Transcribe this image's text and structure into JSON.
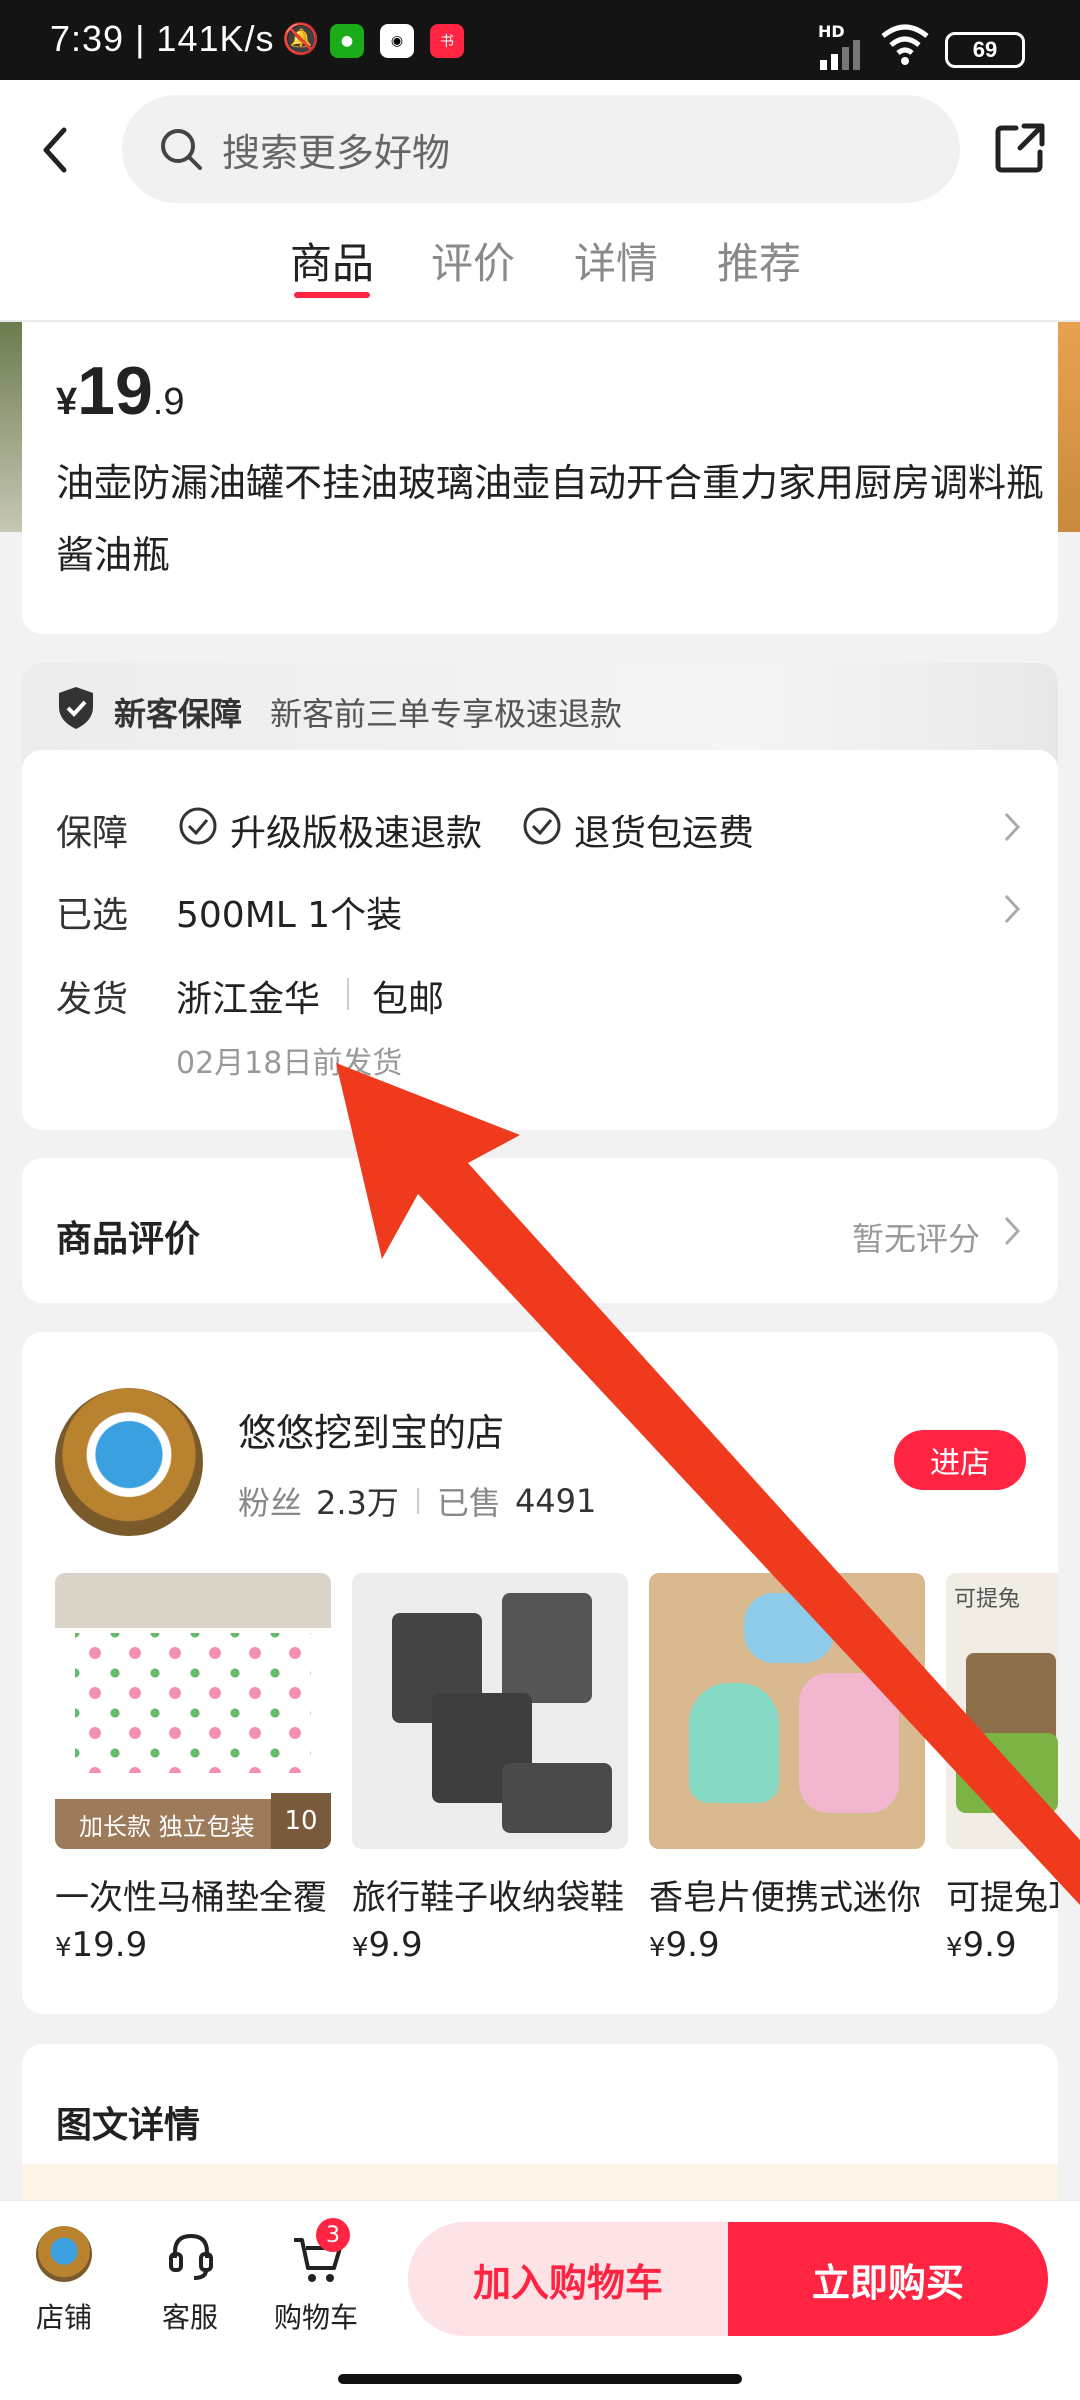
{
  "status_bar": {
    "time": "7:39 | 141K/s",
    "battery": "69",
    "network": "HD"
  },
  "header": {
    "search_placeholder": "搜索更多好物"
  },
  "tabs": [
    "商品",
    "评价",
    "详情",
    "推荐"
  ],
  "product": {
    "price_symbol": "¥",
    "price_int": "19",
    "price_dec": ".9",
    "title": "油壶防漏油罐不挂油玻璃油壶自动开合重力家用厨房调料瓶酱油瓶"
  },
  "guarantee_banner": {
    "title": "新客保障",
    "text": "新客前三单专享极速退款"
  },
  "info": {
    "guarantee_label": "保障",
    "guarantee_items": [
      "升级版极速退款",
      "退货包运费"
    ],
    "selected_label": "已选",
    "selected_value": "500ML 1个装",
    "shipping_label": "发货",
    "shipping_from": "浙江金华",
    "shipping_fee": "包邮",
    "shipping_time": "02月18日前发货"
  },
  "reviews": {
    "title": "商品评价",
    "status": "暂无评分"
  },
  "store": {
    "name": "悠悠挖到宝的店",
    "fans_label": "粉丝",
    "fans_value": "2.3万",
    "sold_label": "已售",
    "sold_value": "4491",
    "enter_label": "进店"
  },
  "recommend": [
    {
      "name": "一次性马桶垫全覆",
      "price": "19.9",
      "overlay": "加长款 独立包装",
      "badge": "10"
    },
    {
      "name": "旅行鞋子收纳袋鞋",
      "price": "9.9"
    },
    {
      "name": "香皂片便携式迷你",
      "price": "9.9"
    },
    {
      "name": "可提兔耳",
      "price": "9.9",
      "overlay": "可提兔"
    }
  ],
  "detail_section": {
    "title": "图文详情"
  },
  "bottom": {
    "store_label": "店铺",
    "service_label": "客服",
    "cart_label": "购物车",
    "cart_count": "3",
    "add_cart": "加入购物车",
    "buy_now": "立即购买"
  },
  "colors": {
    "accent": "#ff2442",
    "arrow": "#f03a1e"
  }
}
